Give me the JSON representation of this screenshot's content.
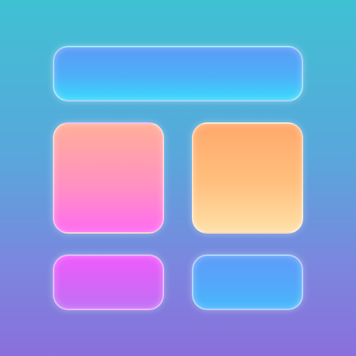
{
  "app_icon": {
    "icon_name": "layout-grid-icon",
    "background_gradient": [
      "#3fc1d3",
      "#8a6fdc"
    ],
    "tiles": [
      {
        "role": "header-tile",
        "colors": [
          "#5a9bf7",
          "#3ad8fc"
        ]
      },
      {
        "role": "pink-tile",
        "colors": [
          "#ffae98",
          "#ff6bf0"
        ]
      },
      {
        "role": "orange-tile",
        "colors": [
          "#ffa86c",
          "#ffe0a8"
        ]
      },
      {
        "role": "magenta-tile",
        "colors": [
          "#ee5bfa",
          "#c070f6"
        ]
      },
      {
        "role": "blue-tile",
        "colors": [
          "#5d9cf9",
          "#48b8fb"
        ]
      }
    ]
  }
}
